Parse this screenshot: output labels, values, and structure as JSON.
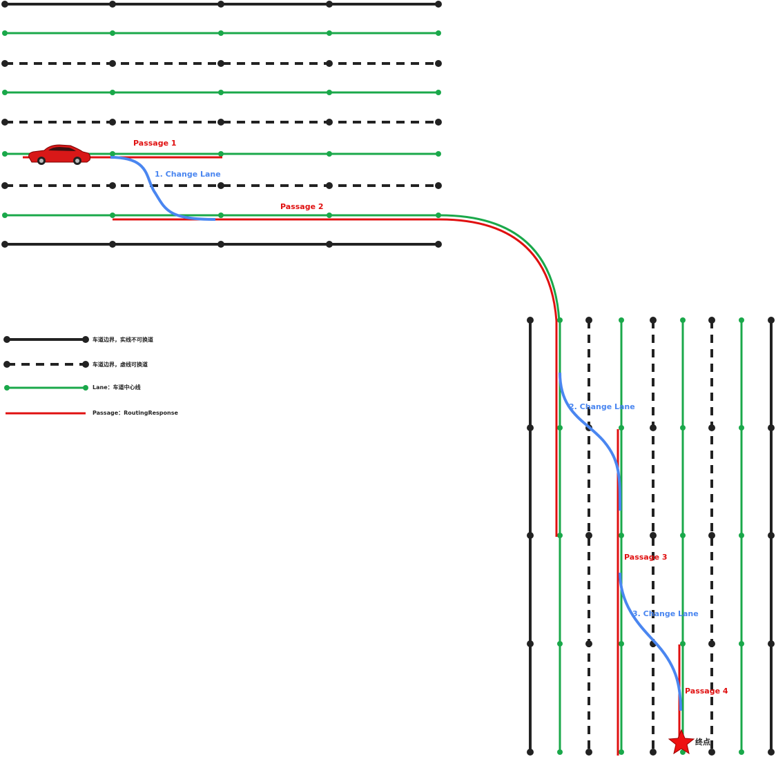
{
  "colors": {
    "boundary": "#222222",
    "lane": "#1aa84a",
    "passage": "#e01010",
    "change_lane": "#4a86f0",
    "goal": "#ee1111"
  },
  "annotations": {
    "passage_1": "Passage 1",
    "passage_2": "Passage 2",
    "passage_3": "Passage 3",
    "passage_4": "Passage 4",
    "change_lane_1": "1. Change Lane",
    "change_lane_2": "2. Change Lane",
    "change_lane_3": "3. Change Lane",
    "goal": "终点"
  },
  "legend": {
    "solid_boundary": "车道边界，实线不可换道",
    "dashed_boundary": "车道边界，虚线可换道",
    "lane": "Lane：车道中心线",
    "passage": "Passage：RoutingResponse"
  },
  "icons": {
    "vehicle": "red-car-icon",
    "goal": "red-star-icon"
  }
}
